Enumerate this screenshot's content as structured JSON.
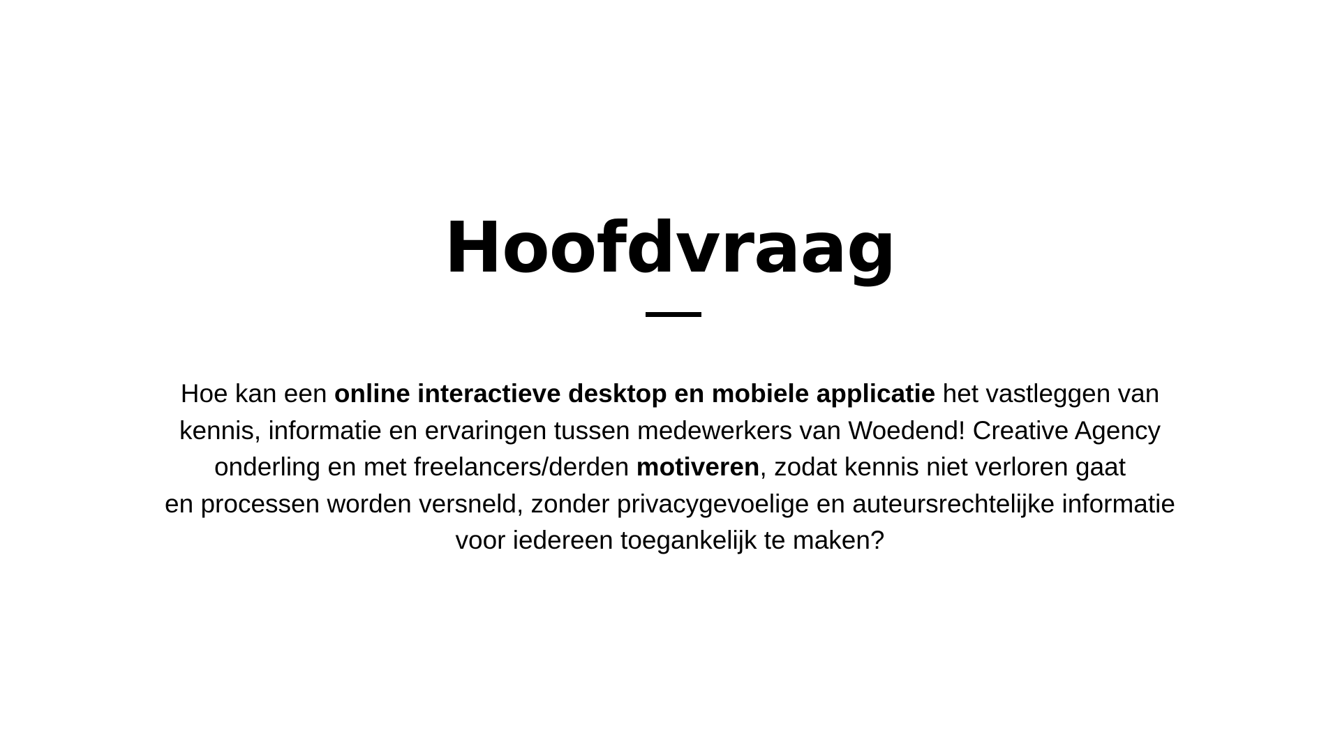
{
  "slide": {
    "title": "Hoofdvraag",
    "body": {
      "line1": {
        "a": "Hoe kan een ",
        "b": "online interactieve desktop en mobiele applicatie",
        "c": " het vastleggen van"
      },
      "line2": "kennis, informatie en ervaringen tussen medewerkers van Woedend! Creative Agency",
      "line3": {
        "a": "onderling en met freelancers/derden ",
        "b": "motiveren",
        "c": ", zodat kennis niet verloren gaat"
      },
      "line4": "en processen worden versneld, zonder privacygevoelige en auteursrechtelijke informatie",
      "line5": "voor iedereen toegankelijk te maken?"
    }
  },
  "colors": {
    "background": "#ffffff",
    "text": "#000000"
  }
}
